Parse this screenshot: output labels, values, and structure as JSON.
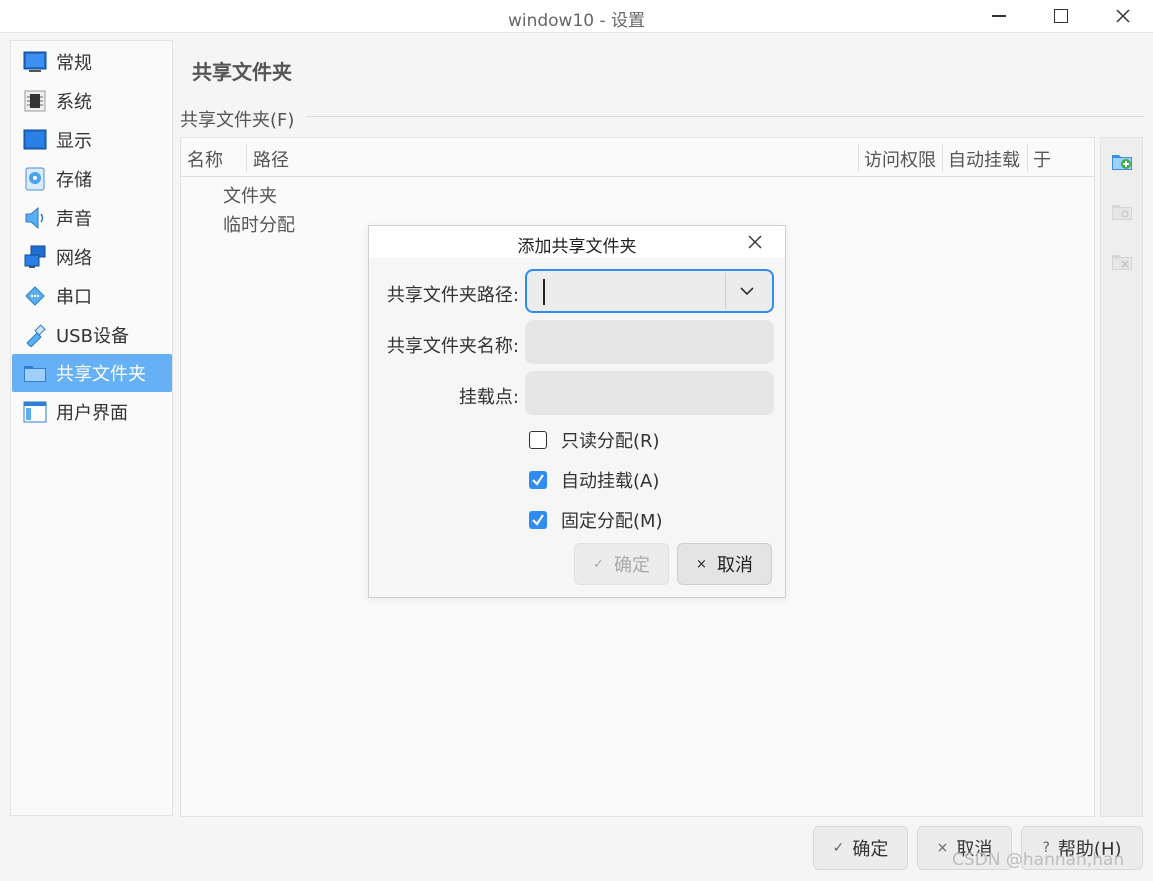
{
  "window": {
    "title": "window10 - 设置"
  },
  "sidebar": {
    "items": [
      {
        "label": "常规",
        "icon": "monitor-icon"
      },
      {
        "label": "系统",
        "icon": "chip-icon"
      },
      {
        "label": "显示",
        "icon": "display-icon"
      },
      {
        "label": "存储",
        "icon": "disk-icon"
      },
      {
        "label": "声音",
        "icon": "speaker-icon"
      },
      {
        "label": "网络",
        "icon": "network-icon"
      },
      {
        "label": "串口",
        "icon": "serial-port-icon"
      },
      {
        "label": "USB设备",
        "icon": "usb-icon"
      },
      {
        "label": "共享文件夹",
        "icon": "folder-icon",
        "selected": true
      },
      {
        "label": "用户界面",
        "icon": "window-layout-icon"
      }
    ]
  },
  "main": {
    "title": "共享文件夹",
    "group_label": "共享文件夹(F)",
    "columns": [
      "名称",
      "路径",
      "访问权限",
      "自动挂载",
      "于"
    ],
    "tree": [
      "文件夹",
      "临时分配"
    ]
  },
  "dialog": {
    "title": "添加共享文件夹",
    "path_label": "共享文件夹路径:",
    "path_value": "",
    "name_label": "共享文件夹名称:",
    "name_value": "",
    "mount_label": "挂载点:",
    "mount_value": "",
    "checkboxes": [
      {
        "label": "只读分配(R)",
        "checked": false
      },
      {
        "label": "自动挂载(A)",
        "checked": true
      },
      {
        "label": "固定分配(M)",
        "checked": true
      }
    ],
    "ok_label": "确定",
    "cancel_label": "取消"
  },
  "buttons": {
    "ok": "确定",
    "cancel": "取消",
    "help": "帮助(H)"
  },
  "watermark": "CSDN @hannan,han",
  "colors": {
    "accent": "#2f8cf1",
    "selection": "#66b0f5"
  }
}
